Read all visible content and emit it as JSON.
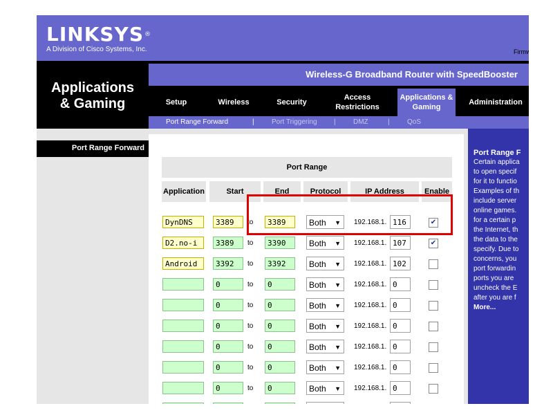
{
  "header": {
    "brand": "LINKSYS",
    "registered": "®",
    "subtitle": "A Division of Cisco Systems, Inc.",
    "firmware_label": "Firmw"
  },
  "left": {
    "section_title_line1": "Applications",
    "section_title_line2": "& Gaming",
    "nav_item": "Port Range Forward"
  },
  "product_name": "Wireless-G Broadband Router with SpeedBooster",
  "tabs": [
    {
      "label": "Setup",
      "active": false
    },
    {
      "label": "Wireless",
      "active": false
    },
    {
      "label": "Security",
      "active": false
    },
    {
      "label": "Access Restrictions",
      "active": false
    },
    {
      "label": "Applications & Gaming",
      "active": true
    },
    {
      "label": "Administration",
      "active": false
    }
  ],
  "subtabs": [
    {
      "label": "Port Range Forward",
      "active": true
    },
    {
      "label": "Port Triggering",
      "active": false
    },
    {
      "label": "DMZ",
      "active": false
    },
    {
      "label": "QoS",
      "active": false
    }
  ],
  "subtab_separator": "|",
  "table": {
    "title": "Port Range",
    "columns": {
      "application": "Application",
      "start": "Start",
      "end": "End",
      "protocol": "Protocol",
      "ip": "IP Address",
      "enable": "Enable"
    },
    "to_label": "to",
    "ip_prefix": "192.168.1.",
    "rows": [
      {
        "app": "DynDNS",
        "start": "3389",
        "end": "3389",
        "protocol": "Both",
        "ip": "116",
        "enabled": true
      },
      {
        "app": "D2.no-i",
        "start": "3389",
        "end": "3390",
        "protocol": "Both",
        "ip": "107",
        "enabled": true
      },
      {
        "app": "Android",
        "start": "3392",
        "end": "3392",
        "protocol": "Both",
        "ip": "102",
        "enabled": false
      },
      {
        "app": "",
        "start": "0",
        "end": "0",
        "protocol": "Both",
        "ip": "0",
        "enabled": false
      },
      {
        "app": "",
        "start": "0",
        "end": "0",
        "protocol": "Both",
        "ip": "0",
        "enabled": false
      },
      {
        "app": "",
        "start": "0",
        "end": "0",
        "protocol": "Both",
        "ip": "0",
        "enabled": false
      },
      {
        "app": "",
        "start": "0",
        "end": "0",
        "protocol": "Both",
        "ip": "0",
        "enabled": false
      },
      {
        "app": "",
        "start": "0",
        "end": "0",
        "protocol": "Both",
        "ip": "0",
        "enabled": false
      },
      {
        "app": "",
        "start": "0",
        "end": "0",
        "protocol": "Both",
        "ip": "0",
        "enabled": false
      },
      {
        "app": "",
        "start": "0",
        "end": "0",
        "protocol": "Both",
        "ip": "0",
        "enabled": false
      }
    ]
  },
  "help": {
    "title": "Port Range F",
    "lines": [
      "Certain applica",
      "to open specif",
      "for it to functio",
      "Examples of th",
      "include server",
      "online games.",
      "for a certain p",
      "the Internet, th",
      "the data to the",
      "specify. Due to",
      "concerns, you",
      "port forwardin",
      "ports you are",
      "uncheck the E",
      "after you are f"
    ],
    "more": "More..."
  },
  "colors": {
    "header_purple": "#6666cc",
    "help_blue": "#3333aa",
    "highlight_red": "#e00000",
    "green_field": "#ccffcc",
    "yellow_field": "#ffffcc"
  }
}
